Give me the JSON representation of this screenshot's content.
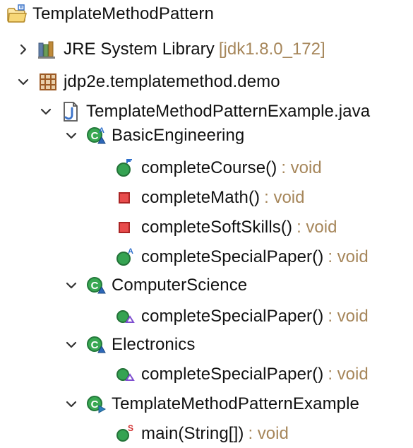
{
  "tree": {
    "project": {
      "name": "TemplateMethodPattern",
      "icon": "java-project-folder-icon"
    },
    "library": {
      "name": "JRE System Library",
      "detail": "[jdk1.8.0_172]",
      "icon": "library-icon"
    },
    "package": {
      "name": "jdp2e.templatemethod.demo",
      "icon": "package-icon"
    },
    "file": {
      "name": "TemplateMethodPatternExample.java",
      "icon": "java-file-icon"
    },
    "classes": [
      {
        "name": "BasicEngineering",
        "icon": "abstract-class-icon",
        "members": [
          {
            "name": "completeCourse()",
            "return_type": ": void",
            "icon": "public-final-method-icon"
          },
          {
            "name": "completeMath()",
            "return_type": ": void",
            "icon": "private-method-icon"
          },
          {
            "name": "completeSoftSkills()",
            "return_type": ": void",
            "icon": "private-method-icon"
          },
          {
            "name": "completeSpecialPaper()",
            "return_type": ": void",
            "icon": "public-abstract-method-icon"
          }
        ]
      },
      {
        "name": "ComputerScience",
        "icon": "class-icon",
        "members": [
          {
            "name": "completeSpecialPaper()",
            "return_type": ": void",
            "icon": "overriding-method-icon"
          }
        ]
      },
      {
        "name": "Electronics",
        "icon": "class-icon",
        "members": [
          {
            "name": "completeSpecialPaper()",
            "return_type": ": void",
            "icon": "overriding-method-icon"
          }
        ]
      },
      {
        "name": "TemplateMethodPatternExample",
        "icon": "runnable-class-icon",
        "members": [
          {
            "name": "main(String[])",
            "return_type": ": void",
            "icon": "static-method-icon"
          }
        ]
      }
    ]
  },
  "colors": {
    "text": "#111111",
    "type_text": "#a6865a",
    "library_detail": "#a6865a",
    "class_green": "#2f9e44",
    "method_green": "#2f9e44",
    "private_red": "#d73b3b",
    "package_brown": "#a65b22",
    "java_blue": "#3b73c9"
  }
}
